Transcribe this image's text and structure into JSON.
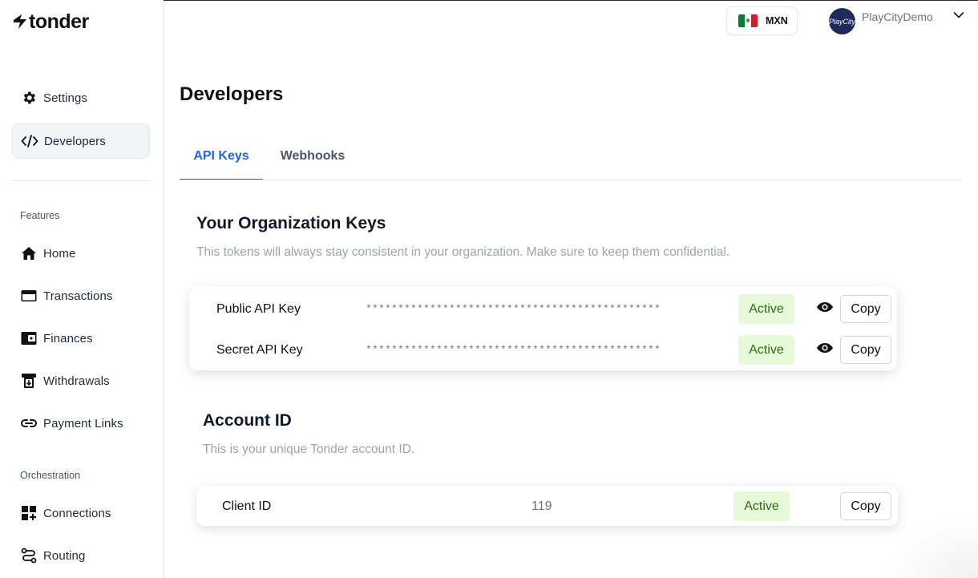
{
  "brand": {
    "logo_text": "tonder"
  },
  "sidebar": {
    "top_items": [
      {
        "label": "Settings",
        "icon": "gear-icon"
      },
      {
        "label": "Developers",
        "icon": "code-icon",
        "active": true
      }
    ],
    "sections": [
      {
        "label": "Features",
        "items": [
          {
            "label": "Home",
            "icon": "home-icon"
          },
          {
            "label": "Transactions",
            "icon": "card-icon"
          },
          {
            "label": "Finances",
            "icon": "wallet-icon"
          },
          {
            "label": "Withdrawals",
            "icon": "withdraw-icon"
          },
          {
            "label": "Payment Links",
            "icon": "link-icon"
          }
        ]
      },
      {
        "label": "Orchestration",
        "items": [
          {
            "label": "Connections",
            "icon": "connections-icon"
          },
          {
            "label": "Routing",
            "icon": "routing-icon"
          }
        ]
      }
    ]
  },
  "header": {
    "currency": {
      "code": "MXN",
      "flag": "mexico-flag-icon"
    },
    "account": {
      "name": "PlayCityDemo",
      "avatar_text": "PlayCity"
    }
  },
  "main": {
    "title": "Developers",
    "tabs": [
      {
        "label": "API Keys",
        "active": true
      },
      {
        "label": "Webhooks",
        "active": false
      }
    ],
    "org_keys": {
      "title": "Your Organization Keys",
      "subtitle": "This tokens will always stay consistent in your organization. Make sure to keep them confidential.",
      "rows": [
        {
          "label": "Public API Key",
          "masked": "**********************************************",
          "status": "Active",
          "copy_label": "Copy"
        },
        {
          "label": "Secret API Key",
          "masked": "**********************************************",
          "status": "Active",
          "copy_label": "Copy"
        }
      ]
    },
    "account_id": {
      "title": "Account ID",
      "subtitle": "This is your unique Tonder account ID.",
      "row": {
        "label": "Client ID",
        "value": "119",
        "status": "Active",
        "copy_label": "Copy"
      }
    }
  },
  "colors": {
    "accent": "#2563eb",
    "active_badge_bg": "#e6f9d8",
    "active_badge_text": "#2f6b15"
  }
}
